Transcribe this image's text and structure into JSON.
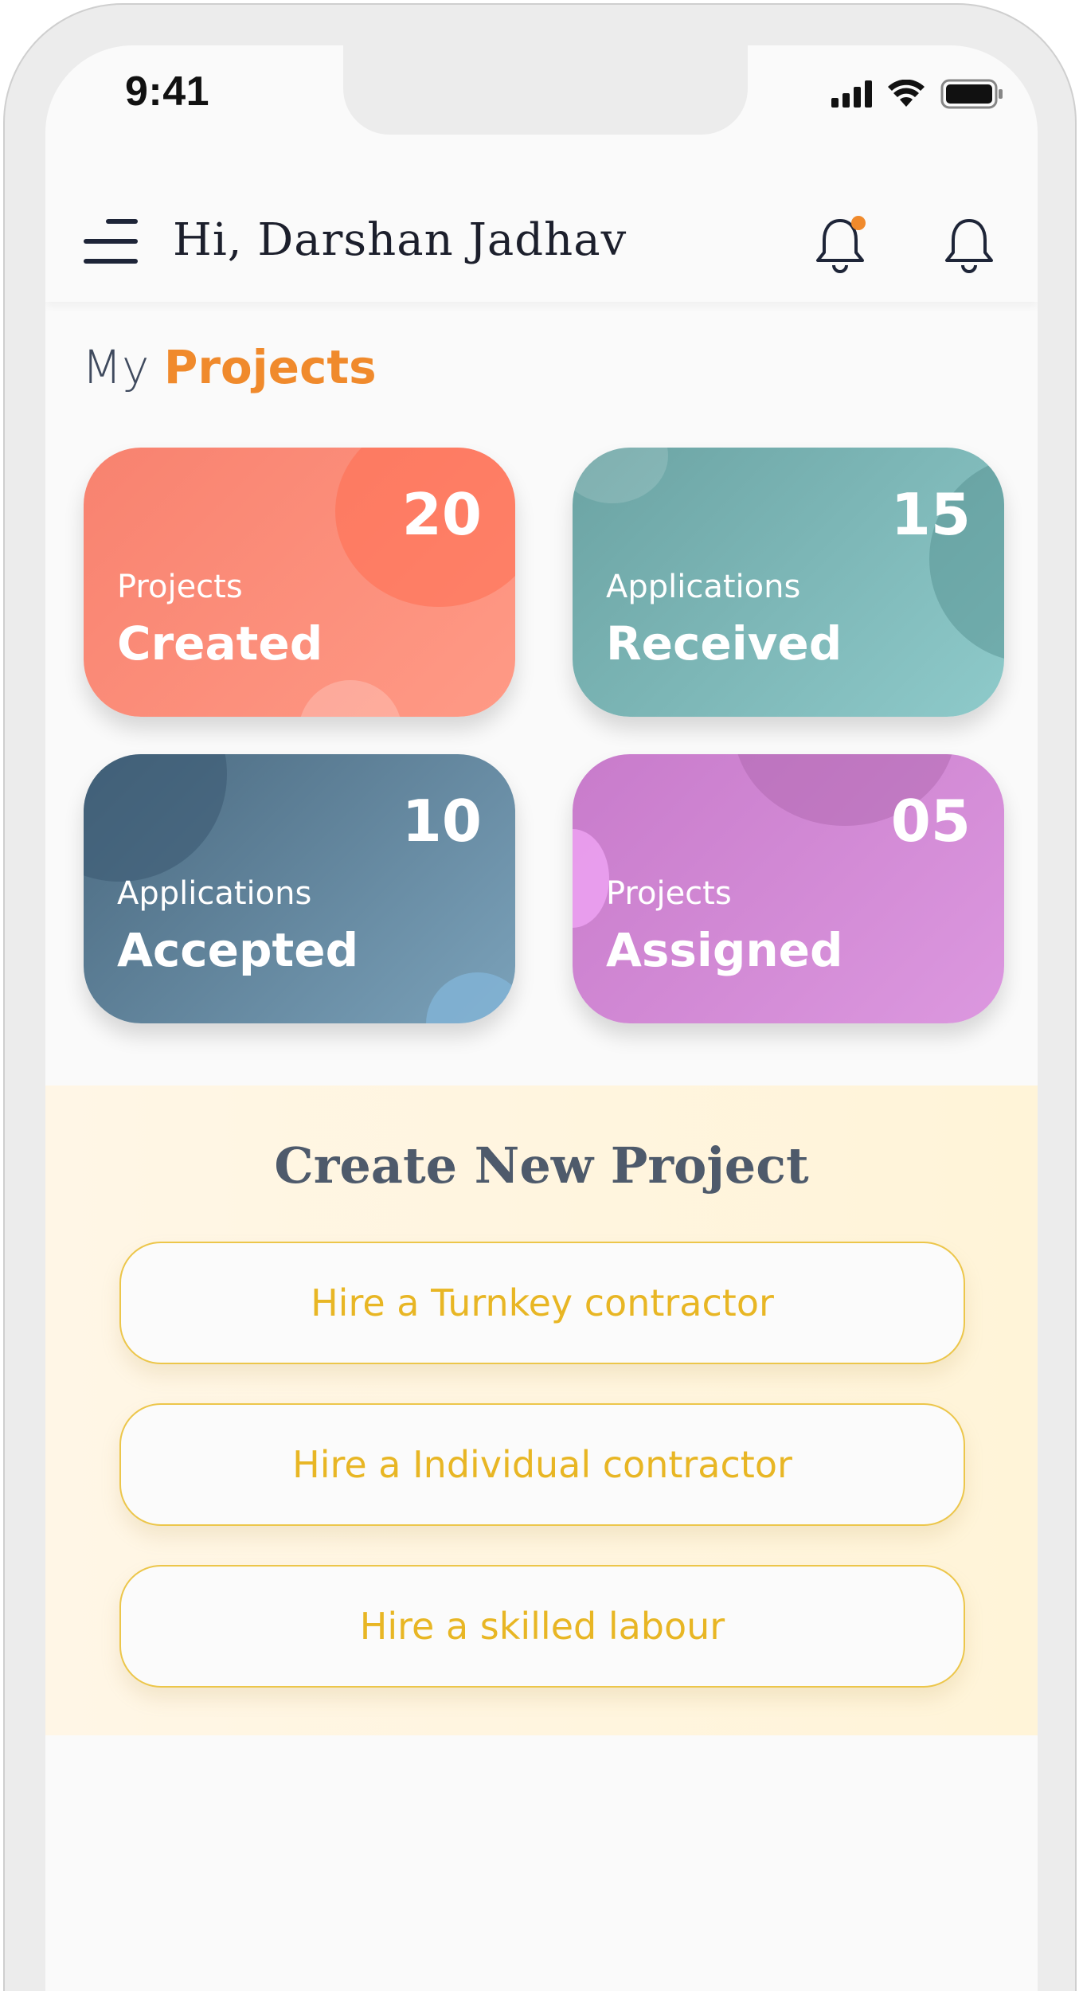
{
  "status_bar": {
    "time": "9:41"
  },
  "header": {
    "greeting": "Hi, Darshan Jadhav",
    "notification_dot_color": "#f08a2c"
  },
  "section": {
    "title_prefix": "My",
    "title_highlight": "Projects"
  },
  "cards": [
    {
      "count": "20",
      "label_top": "Projects",
      "label_bottom": "Created",
      "color": "#f8826f"
    },
    {
      "count": "15",
      "label_top": "Applications",
      "label_bottom": "Received",
      "color": "#6ba3a3"
    },
    {
      "count": "10",
      "label_top": "Applications",
      "label_bottom": "Accepted",
      "color": "#4a6980"
    },
    {
      "count": "05",
      "label_top": "Projects",
      "label_bottom": "Assigned",
      "color": "#c87bcb"
    }
  ],
  "create_project": {
    "title": "Create New Project",
    "buttons": [
      "Hire a Turnkey contractor",
      "Hire a Individual contractor",
      "Hire a skilled labour"
    ],
    "accent_color": "#e8b624"
  }
}
